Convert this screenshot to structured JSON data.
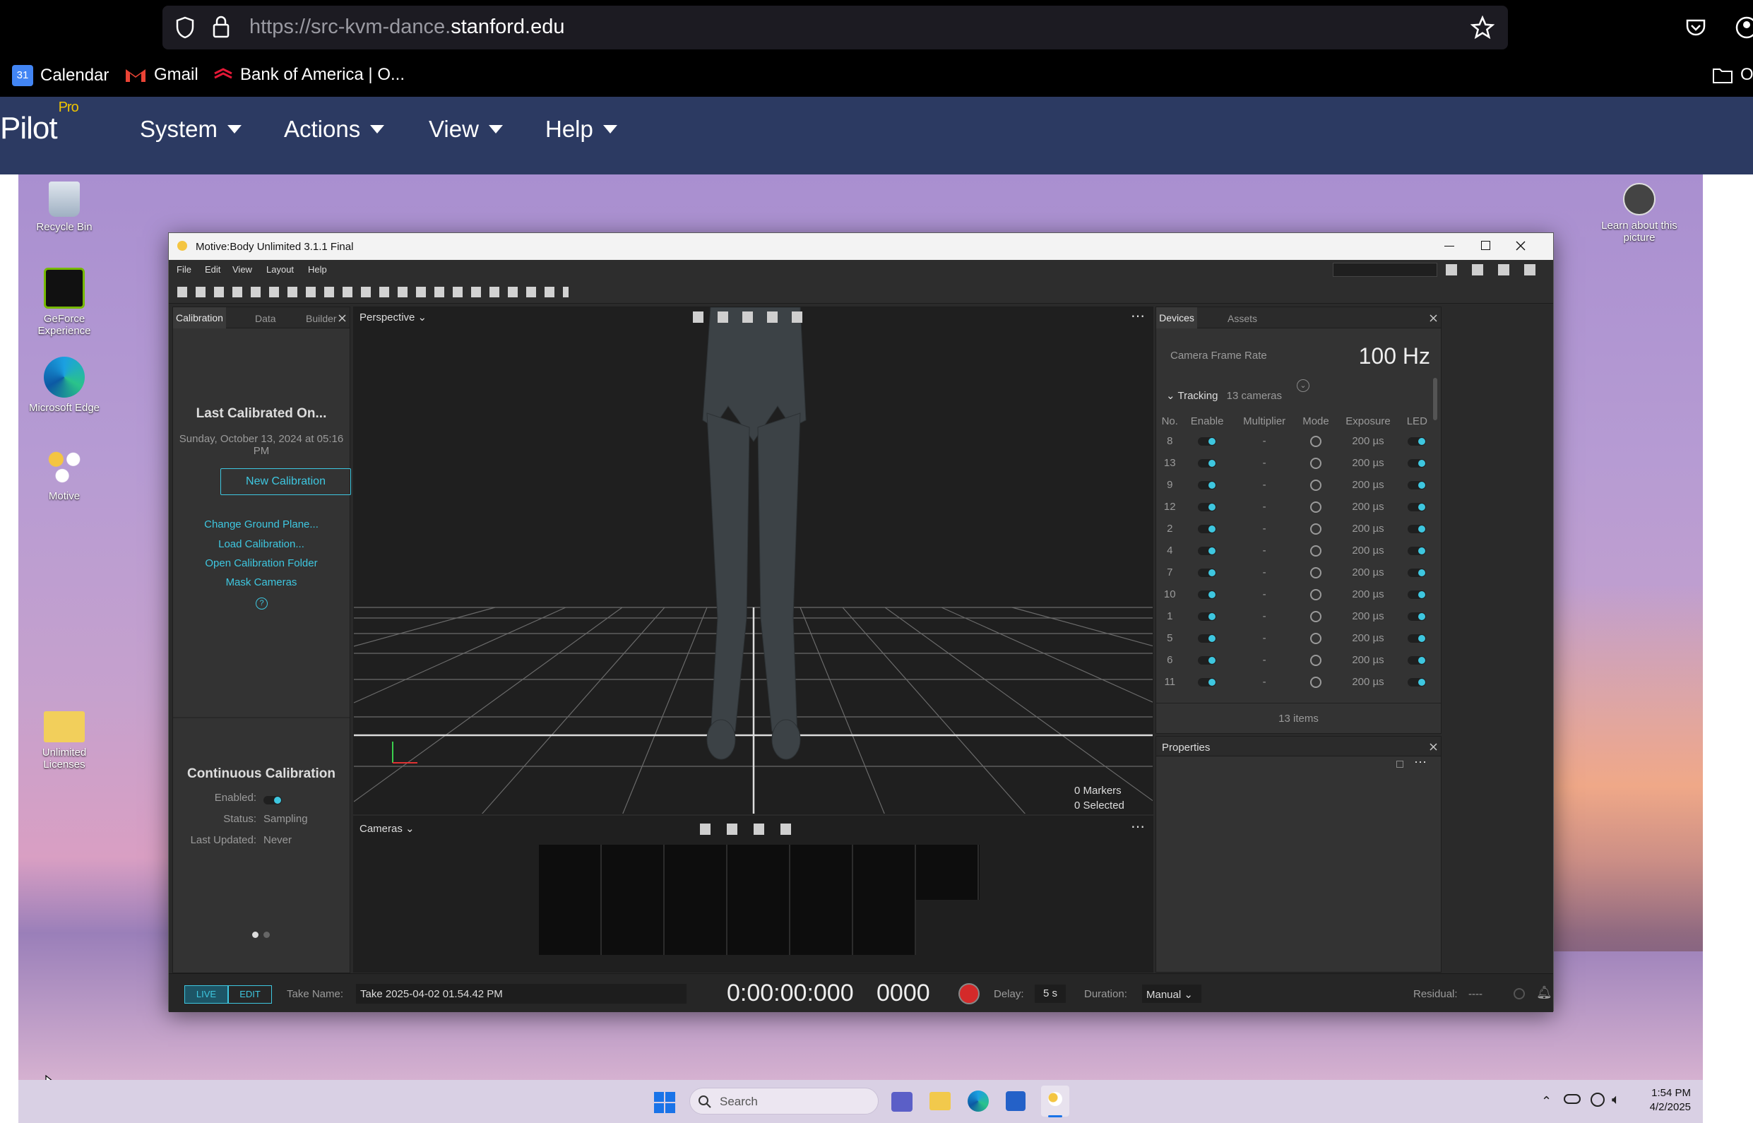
{
  "browser": {
    "url_prefix": "https://src-kvm-dance.",
    "url_domain": "stanford.edu",
    "bookmarks": [
      "Calendar",
      "Gmail",
      "Bank of America | O..."
    ],
    "bookmarks_right": "Ot",
    "calendar_day": "31"
  },
  "pilot": {
    "logo": "Pilot",
    "logo_sup": "Pro",
    "menus": [
      "System",
      "Actions",
      "View",
      "Help"
    ]
  },
  "desktop": {
    "icons": [
      "Recycle Bin",
      "GeForce Experience",
      "Microsoft Edge",
      "Motive",
      "Unlimited Licenses"
    ],
    "learn": "Learn about this picture"
  },
  "motive": {
    "title": "Motive:Body Unlimited 3.1.1 Final",
    "menu": [
      "File",
      "Edit",
      "View",
      "Layout",
      "Help"
    ],
    "left_tabs": [
      "Calibration",
      "Data",
      "Builder"
    ],
    "calib": {
      "heading": "Last Calibrated On...",
      "date": "Sunday, October 13, 2024 at 05:16 PM",
      "new_btn": "New Calibration",
      "links": [
        "Change Ground Plane...",
        "Load Calibration...",
        "Open Calibration Folder",
        "Mask Cameras"
      ],
      "help": "?",
      "cont_heading": "Continuous Calibration",
      "enabled_label": "Enabled:",
      "status_label": "Status:",
      "status_value": "Sampling",
      "updated_label": "Last Updated:",
      "updated_value": "Never"
    },
    "viewport": {
      "mode": "Perspective",
      "markers": "0 Markers",
      "selected": "0 Selected",
      "cameras_label": "Cameras"
    },
    "devices": {
      "tabs": [
        "Devices",
        "Assets"
      ],
      "frame_rate_label": "Camera Frame Rate",
      "frame_rate": "100 Hz",
      "tracking_label": "Tracking",
      "tracking_count": "13 cameras",
      "columns": [
        "No.",
        "Enable",
        "Multiplier",
        "Mode",
        "Exposure",
        "LED"
      ],
      "rows": [
        {
          "no": "8",
          "mult": "-",
          "exp": "200 µs"
        },
        {
          "no": "13",
          "mult": "-",
          "exp": "200 µs"
        },
        {
          "no": "9",
          "mult": "-",
          "exp": "200 µs"
        },
        {
          "no": "12",
          "mult": "-",
          "exp": "200 µs"
        },
        {
          "no": "2",
          "mult": "-",
          "exp": "200 µs"
        },
        {
          "no": "4",
          "mult": "-",
          "exp": "200 µs"
        },
        {
          "no": "7",
          "mult": "-",
          "exp": "200 µs"
        },
        {
          "no": "10",
          "mult": "-",
          "exp": "200 µs"
        },
        {
          "no": "1",
          "mult": "-",
          "exp": "200 µs"
        },
        {
          "no": "5",
          "mult": "-",
          "exp": "200 µs"
        },
        {
          "no": "6",
          "mult": "-",
          "exp": "200 µs"
        },
        {
          "no": "11",
          "mult": "-",
          "exp": "200 µs"
        }
      ],
      "items": "13 items"
    },
    "properties_label": "Properties",
    "bottom": {
      "live": "LIVE",
      "edit": "EDIT",
      "take_label": "Take Name:",
      "take_value": "Take 2025-04-02 01.54.42 PM",
      "timecode": "0:00:00:000",
      "frame": "0000",
      "delay_label": "Delay:",
      "delay_value": "5 s",
      "duration_label": "Duration:",
      "duration_value": "Manual",
      "residual_label": "Residual:",
      "residual_value": "----"
    }
  },
  "taskbar": {
    "search": "Search",
    "time": "1:54 PM",
    "date": "4/2/2025"
  },
  "colors": {
    "accent": "#3ec7e0",
    "pilot_bar": "#2c3a62",
    "record": "#d42a2a"
  }
}
